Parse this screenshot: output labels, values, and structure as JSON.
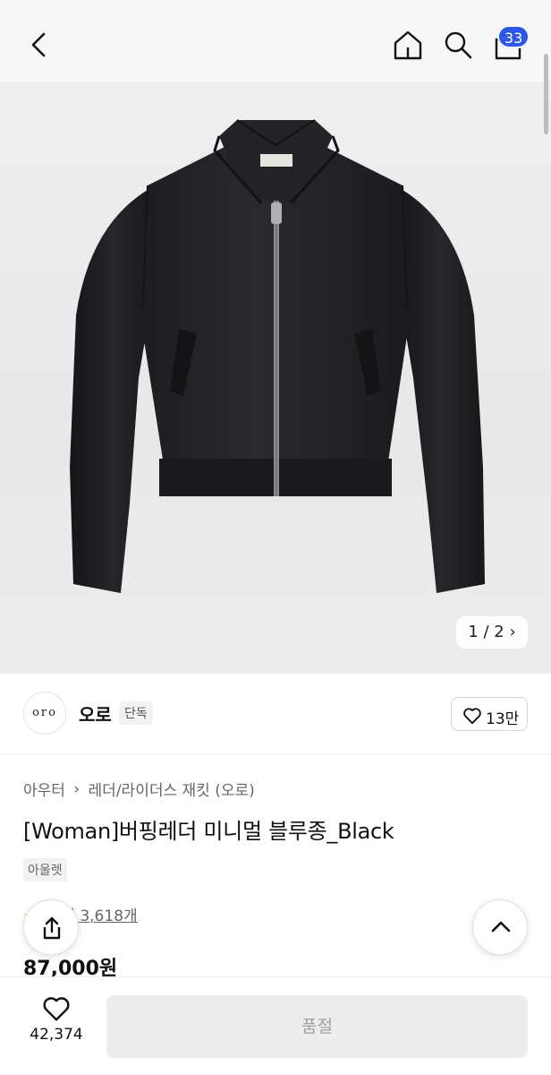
{
  "header": {
    "cart_count": "33"
  },
  "icons": {
    "back": "chevron-left-icon",
    "home": "home-icon",
    "search": "search-icon",
    "cart": "shopping-bag-icon",
    "heart": "heart-icon",
    "share": "share-icon",
    "scroll_top": "chevron-up-icon"
  },
  "gallery": {
    "pager": "1 / 2 ›"
  },
  "brand": {
    "logo_text": "oro",
    "name": "오로",
    "tag": "단독",
    "likes": "13만"
  },
  "product": {
    "breadcrumb": [
      "아우터",
      "레더/라이더스 재킷 (오로)"
    ],
    "breadcrumb_separator": "›",
    "title": "[Woman]버핑레더 미니멀 블루종_Black",
    "label": "아울렛",
    "review_stars": "★",
    "review_text": "후기 3,618개",
    "price": "87,000원"
  },
  "bottom": {
    "wish_count": "42,374",
    "buy_label": "품절"
  },
  "colors": {
    "accent": "#2e56e8",
    "soldout_bg": "#ededed",
    "soldout_text": "#a0a0a0"
  }
}
